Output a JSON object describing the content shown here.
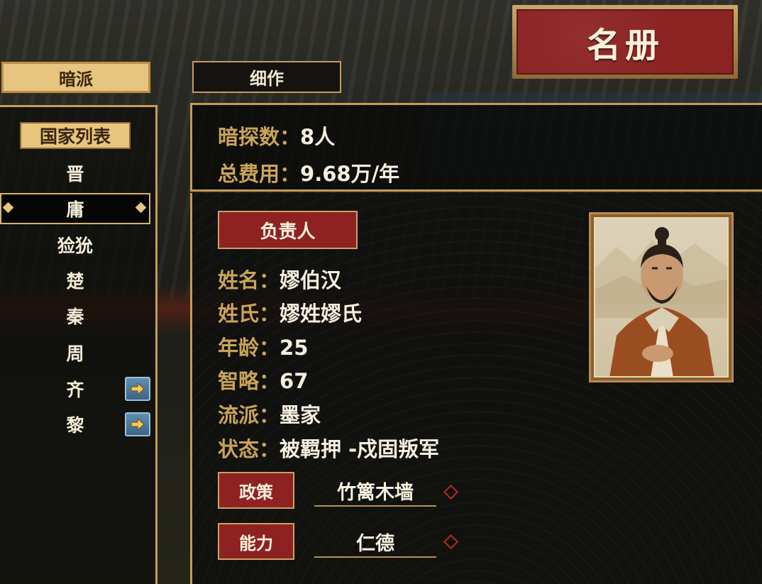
{
  "title": "名册",
  "tabs": {
    "active": "暗派",
    "inactive": "细作"
  },
  "nation_list": {
    "header": "国家列表",
    "items": [
      {
        "name": "晋",
        "selected": false,
        "has_arrow": false
      },
      {
        "name": "庸",
        "selected": true,
        "has_arrow": false
      },
      {
        "name": "猃狁",
        "selected": false,
        "has_arrow": false
      },
      {
        "name": "楚",
        "selected": false,
        "has_arrow": false
      },
      {
        "name": "秦",
        "selected": false,
        "has_arrow": false
      },
      {
        "name": "周",
        "selected": false,
        "has_arrow": false
      },
      {
        "name": "齐",
        "selected": false,
        "has_arrow": true
      },
      {
        "name": "黎",
        "selected": false,
        "has_arrow": true
      }
    ]
  },
  "summary": {
    "spy_count_label": "暗探数：",
    "spy_count_value": "8人",
    "cost_label": "总费用：",
    "cost_value": "9.68万/年"
  },
  "leader": {
    "badge": "负责人",
    "name_label": "姓名：",
    "name_value": "嫪伯汉",
    "clan_label": "姓氏：",
    "clan_value": "嫪姓嫪氏",
    "age_label": "年龄：",
    "age_value": "25",
    "wit_label": "智略：",
    "wit_value": "67",
    "school_label": "流派：",
    "school_value": "墨家",
    "status_label": "状态：",
    "status_value": "被羁押 -戍固叛军"
  },
  "policy": {
    "label": "政策",
    "value": "竹篱木墙"
  },
  "ability": {
    "label": "能力",
    "value": "仁德"
  },
  "colors": {
    "gold": "#c59c55",
    "label_gold": "#c9a45a",
    "red": "#8e2222",
    "button_blue": "#4a7598"
  },
  "icons": {
    "nation_arrow": "arrow-right-icon",
    "selected_marker": "diamond-icon",
    "option_marker": "diamond-outline-icon"
  }
}
